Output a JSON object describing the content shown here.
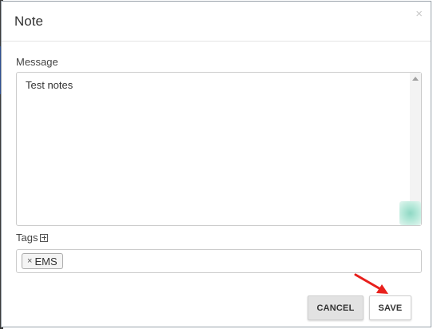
{
  "dialog": {
    "title": "Note",
    "close_glyph": "×"
  },
  "message": {
    "label": "Message",
    "value": "Test notes"
  },
  "tags": {
    "label": "Tags",
    "items": [
      {
        "remove_glyph": "×",
        "label": "EMS"
      }
    ]
  },
  "buttons": {
    "cancel_label": "CANCEL",
    "save_label": "SAVE"
  },
  "colors": {
    "annotation_arrow": "#e8201c",
    "resize_grip": "#8fd8c4"
  }
}
